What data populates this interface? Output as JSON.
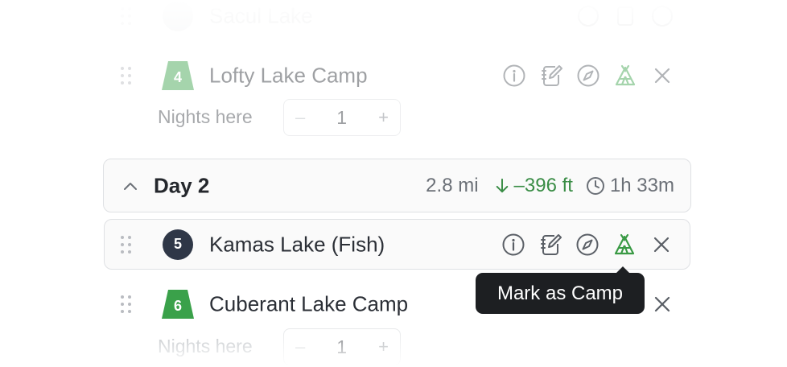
{
  "itinerary": {
    "top_partial_stop": {
      "name": "Sacul Lake"
    },
    "lofty": {
      "number": "4",
      "name": "Lofty Lake Camp",
      "nights_label": "Nights here",
      "nights_value": "1",
      "marker_color": "#6fbf73"
    },
    "day": {
      "title": "Day 2",
      "distance": "2.8 mi",
      "elevation": "–396 ft",
      "duration": "1h 33m",
      "elevation_color": "#3a8d46"
    },
    "kamas": {
      "number": "5",
      "name": "Kamas Lake (Fish)",
      "marker_color": "#2f3747"
    },
    "cuberant": {
      "number": "6",
      "name": "Cuberant Lake Camp",
      "nights_label": "Nights here",
      "nights_value": "1",
      "marker_color": "#3aa14a"
    },
    "stepper": {
      "minus": "–",
      "plus": "+"
    }
  },
  "tooltip": {
    "text": "Mark as Camp"
  },
  "icons": [
    "drag-handle-icon",
    "info-icon",
    "notes-icon",
    "compass-icon",
    "camp-tent-icon",
    "close-icon",
    "chevron-up-icon",
    "arrow-down-icon",
    "clock-icon"
  ]
}
